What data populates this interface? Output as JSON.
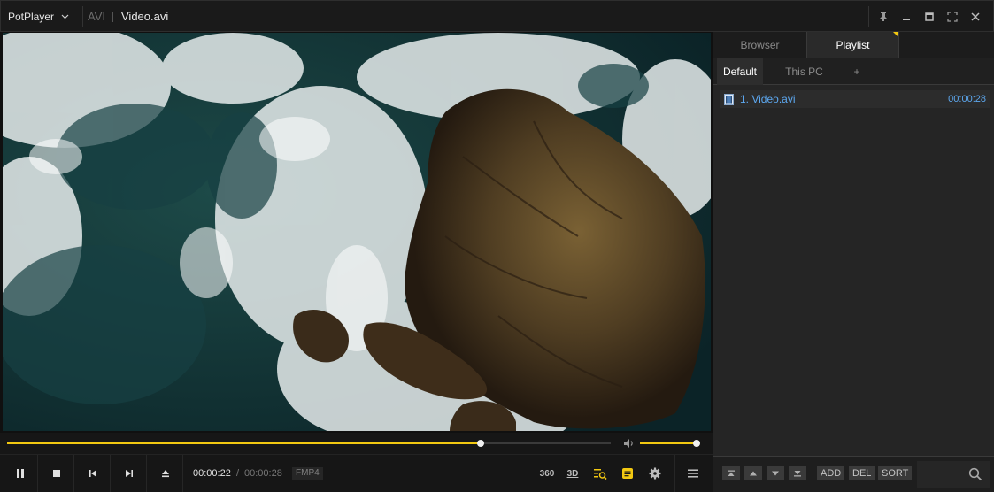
{
  "titlebar": {
    "app_menu": "PotPlayer",
    "format": "AVI",
    "title": "Video.avi"
  },
  "seek": {
    "progress": 0.785
  },
  "volume": {
    "level": 1.0
  },
  "controls": {
    "time_current": "00:00:22",
    "time_separator": "/",
    "time_total": "00:00:28",
    "codec": "FMP4",
    "btn_360": "360",
    "btn_3d": "3D"
  },
  "panel": {
    "tabs": [
      "Browser",
      "Playlist"
    ],
    "subtabs": [
      "Default",
      "This PC",
      "+"
    ],
    "items": [
      {
        "name": "1. Video.avi",
        "duration": "00:00:28"
      }
    ],
    "footer": {
      "add": "ADD",
      "del": "DEL",
      "sort": "SORT"
    }
  },
  "colors": {
    "accent": "#f2c811",
    "link": "#5da8f0",
    "panel_bg": "#252525"
  }
}
